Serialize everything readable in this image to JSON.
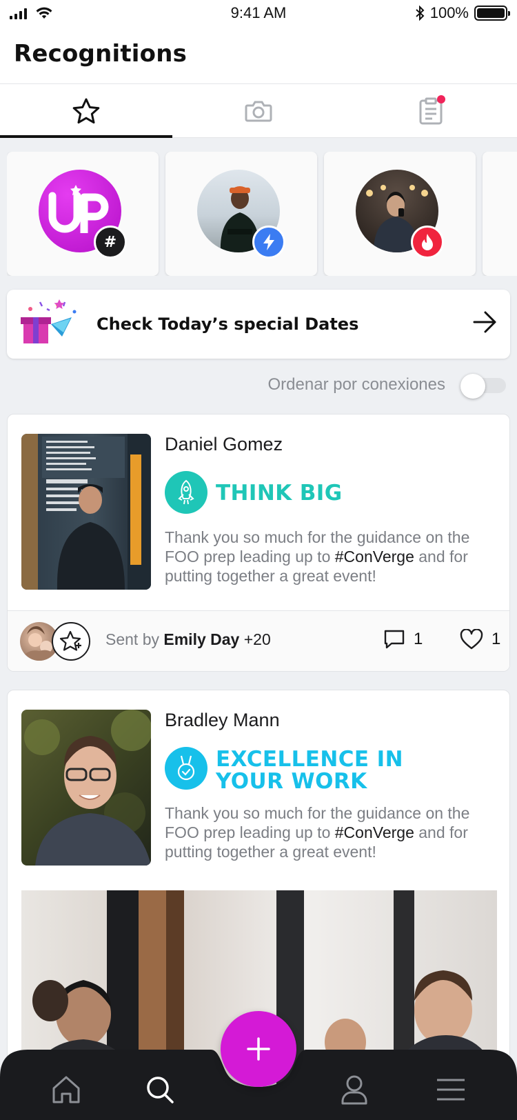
{
  "status_bar": {
    "time": "9:41 AM",
    "battery": "100%"
  },
  "header": {
    "title": "Recognitions"
  },
  "tabs": [
    {
      "name": "star-icon",
      "active": true
    },
    {
      "name": "camera-icon",
      "active": false
    },
    {
      "name": "clipboard-icon",
      "active": false,
      "notification": true
    }
  ],
  "stories": [
    {
      "badge_icon": "hashtag-icon",
      "badge_text": "#",
      "badge_color": "#1c1c1e"
    },
    {
      "badge_icon": "lightning-icon",
      "badge_color": "#3b7cf2"
    },
    {
      "badge_icon": "flame-icon",
      "badge_color": "#f0243e"
    }
  ],
  "special_dates": {
    "label": "Check Today’s special Dates"
  },
  "sort": {
    "label": "Ordenar por conexiones",
    "enabled": false
  },
  "posts": [
    {
      "name": "Daniel Gomez",
      "value_title_lines": [
        "THINK BIG"
      ],
      "value_color": "#1fc6b7",
      "value_icon": "rocket-icon",
      "message_before": "Thank you so much for the guidance on the FOO prep leading up to ",
      "message_tag": "#ConVerge",
      "message_after": " and for putting together a great event!",
      "sent_prefix": "Sent by",
      "sender": "Emily Day",
      "sender_extra": "+20",
      "comments": "1",
      "likes": "1"
    },
    {
      "name": "Bradley Mann",
      "value_title_lines": [
        "EXCELLENCE IN",
        "YOUR WORK"
      ],
      "value_color": "#17c0ea",
      "value_icon": "medal-icon",
      "message_before": "Thank you so much for the guidance on the FOO prep leading up to ",
      "message_tag": "#ConVerge",
      "message_after": " and for putting together a great event!"
    }
  ],
  "bottom_nav": {
    "items": [
      "home-icon",
      "search-icon",
      "profile-icon",
      "menu-icon"
    ],
    "fab_label": "+",
    "fab_color": "#d41ad6"
  }
}
